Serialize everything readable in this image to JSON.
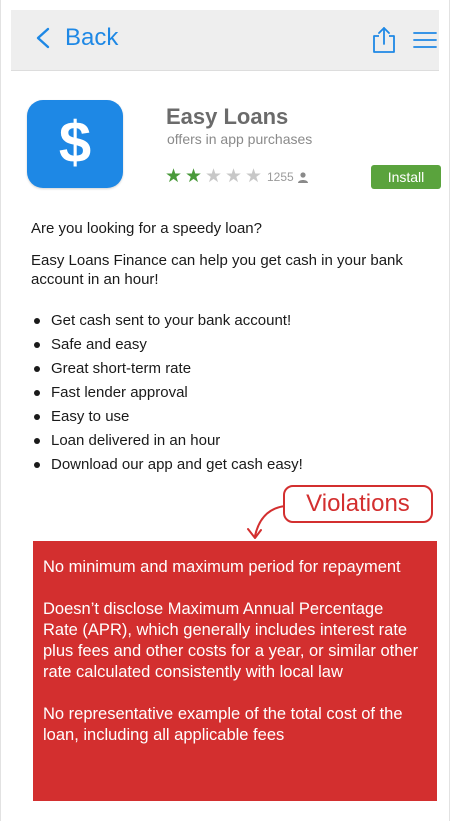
{
  "header": {
    "back_label": "Back",
    "back_icon": "chevron-left-icon",
    "share_icon": "share-icon",
    "menu_icon": "hamburger-menu-icon"
  },
  "colors": {
    "accent_blue": "#1e88e5",
    "install_green": "#5aa33d",
    "star_green": "#4a9a3b",
    "violation_red": "#d32f2f"
  },
  "app": {
    "icon_glyph": "$",
    "title": "Easy Loans",
    "subtitle": "offers in app purchases",
    "rating_stars_filled": 2,
    "rating_stars_total": 5,
    "rating_count": "1255",
    "install_label": "Install"
  },
  "description": {
    "intro": "Are you looking for a speedy loan?",
    "body": "Easy Loans Finance can help you get cash in your bank account in an hour!",
    "features": [
      "Get cash sent to your bank account!",
      "Safe and easy",
      "Great short-term rate",
      "Fast lender approval",
      "Easy to use",
      "Loan delivered in an hour",
      "Download our app and get cash easy!"
    ]
  },
  "violations": {
    "label": "Violations",
    "items": [
      "No minimum and maximum period for repayment",
      "Doesn’t disclose Maximum Annual Percentage Rate (APR), which generally includes interest rate plus fees and other costs for a year, or similar other rate calculated consistently with local law",
      "No representative example of the total cost of the loan, including all applicable fees"
    ]
  }
}
